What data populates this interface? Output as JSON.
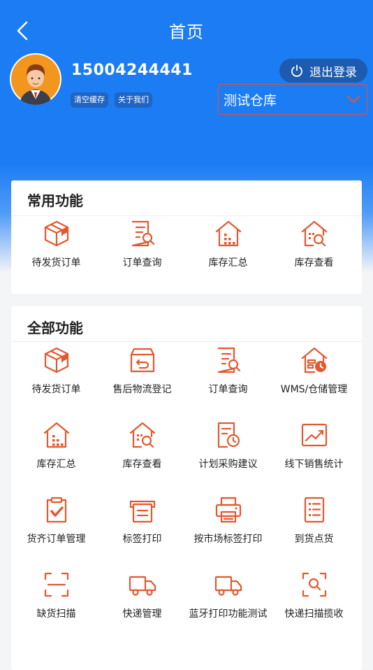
{
  "header": {
    "title": "首页",
    "username": "15004244441",
    "clear_cache": "清空缓存",
    "about_us": "关于我们",
    "logout": "退出登录",
    "warehouse": "测试仓库"
  },
  "common": {
    "title": "常用功能",
    "items": [
      {
        "label": "待发货订单",
        "icon": "box-icon"
      },
      {
        "label": "订单查询",
        "icon": "document-search-icon"
      },
      {
        "label": "库存汇总",
        "icon": "warehouse-icon"
      },
      {
        "label": "库存查看",
        "icon": "warehouse-search-icon"
      }
    ]
  },
  "all": {
    "title": "全部功能",
    "items": [
      {
        "label": "待发货订单",
        "icon": "box-icon"
      },
      {
        "label": "售后物流登记",
        "icon": "return-box-icon"
      },
      {
        "label": "订单查询",
        "icon": "document-search-icon"
      },
      {
        "label": "WMS/仓储管理",
        "icon": "warehouse-clock-icon"
      },
      {
        "label": "库存汇总",
        "icon": "warehouse-icon"
      },
      {
        "label": "库存查看",
        "icon": "warehouse-search-icon"
      },
      {
        "label": "计划采购建议",
        "icon": "document-clock-icon"
      },
      {
        "label": "线下销售统计",
        "icon": "chart-icon"
      },
      {
        "label": "货齐订单管理",
        "icon": "clipboard-check-icon"
      },
      {
        "label": "标签打印",
        "icon": "label-printer-icon"
      },
      {
        "label": "按市场标签打印",
        "icon": "printer-icon"
      },
      {
        "label": "到货点货",
        "icon": "checklist-icon"
      },
      {
        "label": "缺货扫描",
        "icon": "scan-icon"
      },
      {
        "label": "快递管理",
        "icon": "truck-icon"
      },
      {
        "label": "蓝牙打印功能测试",
        "icon": "truck-icon"
      },
      {
        "label": "快递扫描揽收",
        "icon": "scan-search-icon"
      }
    ]
  },
  "colors": {
    "primary": "#1b7cf4",
    "accent": "#e2582f"
  }
}
